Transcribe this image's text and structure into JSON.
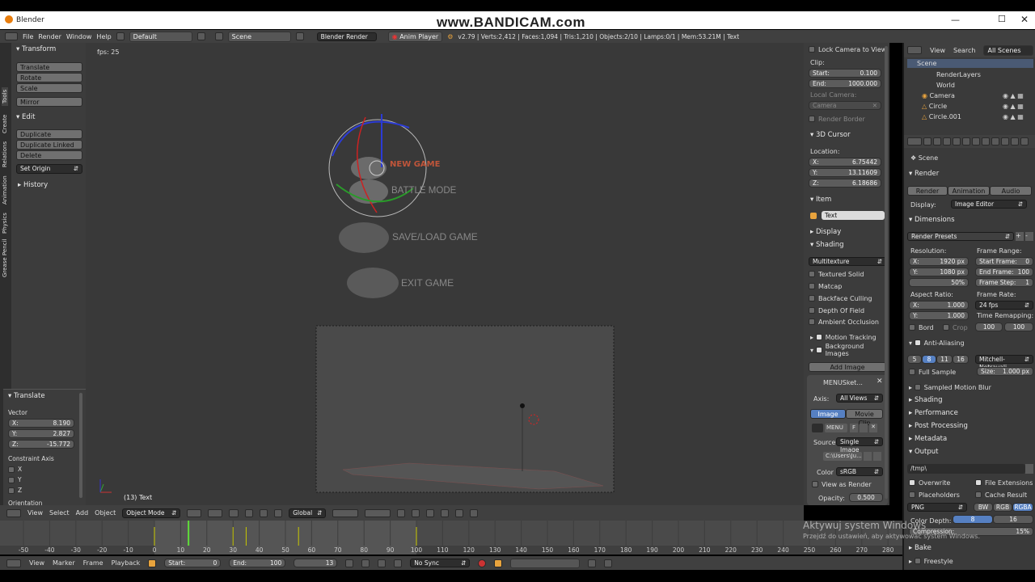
{
  "watermark": "www.BANDICAM.com",
  "window": {
    "title": "Blender"
  },
  "topbar": {
    "menus": [
      "File",
      "Render",
      "Window",
      "Help"
    ],
    "layout": "Default",
    "scene": "Scene",
    "engine": "Blender Render",
    "anim_player": "Anim Player",
    "stats": "v2.79 | Verts:2,412 | Faces:1,094 | Tris:1,210 | Objects:2/10 | Lamps:0/1 | Mem:53.21M | Text"
  },
  "left_tabs": [
    "Tools",
    "Create",
    "Relations",
    "Animation",
    "Physics",
    "Grease Pencil"
  ],
  "toolshelf": {
    "transform_title": "Transform",
    "transform_buttons": [
      "Translate",
      "Rotate",
      "Scale"
    ],
    "mirror": "Mirror",
    "edit_title": "Edit",
    "edit_buttons": [
      "Duplicate",
      "Duplicate Linked",
      "Delete"
    ],
    "set_origin": "Set Origin",
    "history": "History"
  },
  "operator": {
    "title": "Translate",
    "vector_label": "Vector",
    "values": [
      {
        "label": "X:",
        "value": "8.190"
      },
      {
        "label": "Y:",
        "value": "2.827"
      },
      {
        "label": "Z:",
        "value": "-15.772"
      }
    ],
    "constraint_label": "Constraint Axis",
    "axes": [
      "X",
      "Y",
      "Z"
    ],
    "orientation": "Orientation"
  },
  "viewport": {
    "fps": "fps: 25",
    "object_info": "(13) Text",
    "menu_items": [
      "NEW GAME",
      "BATTLE MODE",
      "SAVE/LOAD GAME",
      "EXIT GAME"
    ]
  },
  "viewport_header": {
    "menus": [
      "View",
      "Select",
      "Add",
      "Object"
    ],
    "mode": "Object Mode",
    "orientation": "Global"
  },
  "n_panel": {
    "lock_camera": "Lock Camera to View",
    "clip_label": "Clip:",
    "clip_start": {
      "label": "Start:",
      "value": "0.100"
    },
    "clip_end": {
      "label": "End:",
      "value": "1000.000"
    },
    "local_camera": "Local Camera:",
    "camera": "Camera",
    "render_border": "Render Border",
    "cursor_title": "3D Cursor",
    "location": "Location:",
    "cursor": [
      {
        "label": "X:",
        "value": "6.75442"
      },
      {
        "label": "Y:",
        "value": "13.11609"
      },
      {
        "label": "Z:",
        "value": "6.18686"
      }
    ],
    "item_title": "Item",
    "item_name": "Text",
    "display_title": "Display",
    "shading_title": "Shading",
    "shading_mode": "Multitexture",
    "shading_opts": [
      "Textured Solid",
      "Matcap",
      "Backface Culling",
      "Depth Of Field",
      "Ambient Occlusion"
    ],
    "motion_tracking": "Motion Tracking",
    "background_images": "Background Images",
    "add_image": "Add Image",
    "bg_name": "MENUSket...",
    "axis_label": "Axis:",
    "axis_value": "All Views",
    "tab_image": "Image",
    "tab_clip": "Movie Clip",
    "image_name": "MENU",
    "image_f": "F",
    "source_label": "Source",
    "source_value": "Single Image",
    "path": "C:\\Users\\Ju...",
    "color_label": "Color",
    "color_value": "sRGB",
    "view_as_render": "View as Render",
    "opacity_label": "Opacity:",
    "opacity_value": "0.500"
  },
  "outliner": {
    "menus": [
      "View",
      "Search"
    ],
    "filter": "All Scenes",
    "items": [
      {
        "label": "Scene"
      },
      {
        "label": "RenderLayers"
      },
      {
        "label": "World"
      },
      {
        "label": "Camera"
      },
      {
        "label": "Circle"
      },
      {
        "label": "Circle.001"
      }
    ]
  },
  "properties": {
    "scene": "Scene",
    "render_title": "Render",
    "render_btns": [
      "Render",
      "Animation",
      "Audio"
    ],
    "display_label": "Display:",
    "display_value": "Image Editor",
    "dimensions_title": "Dimensions",
    "render_presets": "Render Presets",
    "resolution_label": "Resolution:",
    "frame_range_label": "Frame Range:",
    "res_x": {
      "label": "X:",
      "value": "1920 px"
    },
    "res_y": {
      "label": "Y:",
      "value": "1080 px"
    },
    "res_pct": "50%",
    "start_frame": {
      "label": "Start Frame:",
      "value": "0"
    },
    "end_frame": {
      "label": "End Frame:",
      "value": "100"
    },
    "frame_step": {
      "label": "Frame Step:",
      "value": "1"
    },
    "aspect_label": "Aspect Ratio:",
    "frame_rate_label": "Frame Rate:",
    "asp_x": {
      "label": "X:",
      "value": "1.000"
    },
    "asp_y": {
      "label": "Y:",
      "value": "1.000"
    },
    "fps": "24 fps",
    "time_remap_label": "Time Remapping:",
    "remap_old": "100",
    "remap_new": "100",
    "bord": "Bord",
    "crop": "Crop",
    "aa_title": "Anti-Aliasing",
    "aa_samples": [
      "5",
      "8",
      "11",
      "16"
    ],
    "aa_filter": "Mitchell-Netravali",
    "full_sample": "Full Sample",
    "size": {
      "label": "Size:",
      "value": "1.000 px"
    },
    "collapsed": [
      "Sampled Motion Blur",
      "Shading",
      "Performance",
      "Post Processing",
      "Metadata"
    ],
    "output_title": "Output",
    "output_path": "/tmp\\",
    "overwrite": "Overwrite",
    "file_ext": "File Extensions",
    "placeholders": "Placeholders",
    "cache_result": "Cache Result",
    "format": "PNG",
    "color_modes": [
      "BW",
      "RGB",
      "RGBA"
    ],
    "color_depth_label": "Color Depth:",
    "depths": [
      "8",
      "16"
    ],
    "compression": {
      "label": "Compression:",
      "value": "15%"
    },
    "bake": "Bake",
    "freestyle": "Freestyle"
  },
  "windows_activation": {
    "title": "Aktywuj system Windows",
    "subtitle": "Przejdź do ustawień, aby aktywować system Windows."
  },
  "timeline": {
    "ruler": [
      "-50",
      "-40",
      "-30",
      "-20",
      "-10",
      "0",
      "10",
      "20",
      "30",
      "40",
      "50",
      "60",
      "70",
      "80",
      "90",
      "100",
      "110",
      "120",
      "130",
      "140",
      "150",
      "160",
      "170",
      "180",
      "190",
      "200",
      "210",
      "220",
      "230",
      "240",
      "250",
      "260",
      "270",
      "280"
    ],
    "keyframes": [
      0,
      13,
      30,
      35,
      55,
      100
    ],
    "current_frame": 13
  },
  "timeline_header": {
    "menus": [
      "View",
      "Marker",
      "Frame",
      "Playback"
    ],
    "start": {
      "label": "Start:",
      "value": "0"
    },
    "end": {
      "label": "End:",
      "value": "100"
    },
    "current": "13",
    "sync": "No Sync"
  }
}
